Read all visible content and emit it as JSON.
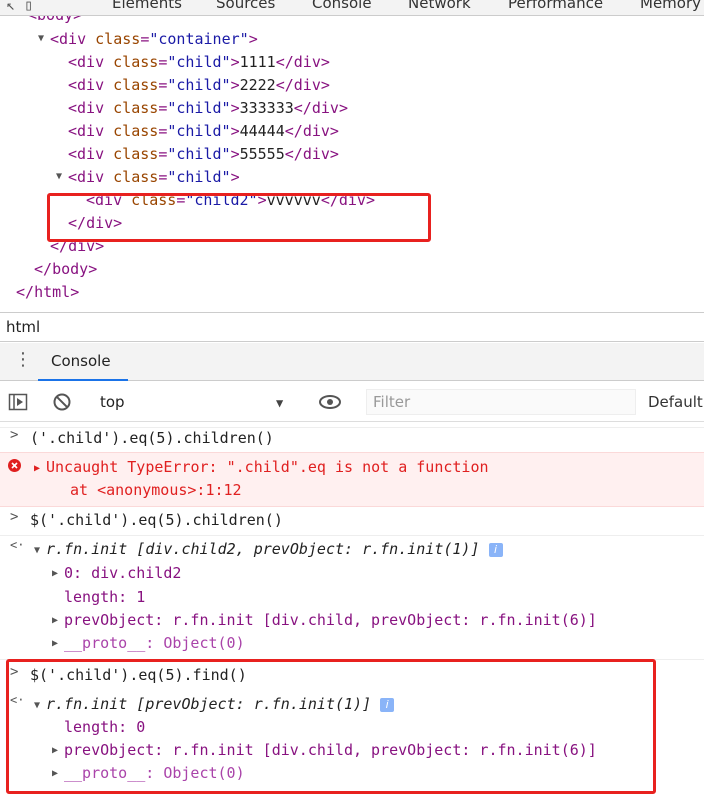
{
  "topbar": {
    "tabs": [
      "Elements",
      "Sources",
      "Console",
      "Network",
      "Performance",
      "Memory"
    ]
  },
  "elements": {
    "lines": [
      "<body>",
      "<div class=\"container\">",
      "1111",
      "2222",
      "333333",
      "44444",
      "55555",
      "vvvvvv"
    ],
    "tag_div": "div",
    "tag_body": "body",
    "tag_html": "html",
    "attr_class": "class",
    "val_container": "\"container\"",
    "val_child": "\"child\"",
    "val_child2": "\"child2\""
  },
  "breadcrumb": "html",
  "console": {
    "tab_label": "Console",
    "context": "top",
    "filter_placeholder": "Filter",
    "levels": "Default"
  },
  "entries": {
    "cmd1": "('.child').eq(5).children()",
    "err1": "Uncaught TypeError: \".child\".eq is not a function",
    "err1_at": "at <anonymous>:1:12",
    "cmd2": "$('.child').eq(5).children()",
    "res2_head": "r.fn.init [div.child2, prevObject: r.fn.init(1)]",
    "res2_item0": "0: div.child2",
    "res2_length": "length: 1",
    "res2_prev": "prevObject: r.fn.init [div.child, prevObject: r.fn.init(6)]",
    "res2_proto": "__proto__: Object(0)",
    "cmd3": "$('.child').eq(5).find()",
    "res3_head": "r.fn.init [prevObject: r.fn.init(1)]",
    "res3_length": "length: 0",
    "res3_prev": "prevObject: r.fn.init [div.child, prevObject: r.fn.init(6)]",
    "res3_proto": "__proto__: Object(0)"
  }
}
